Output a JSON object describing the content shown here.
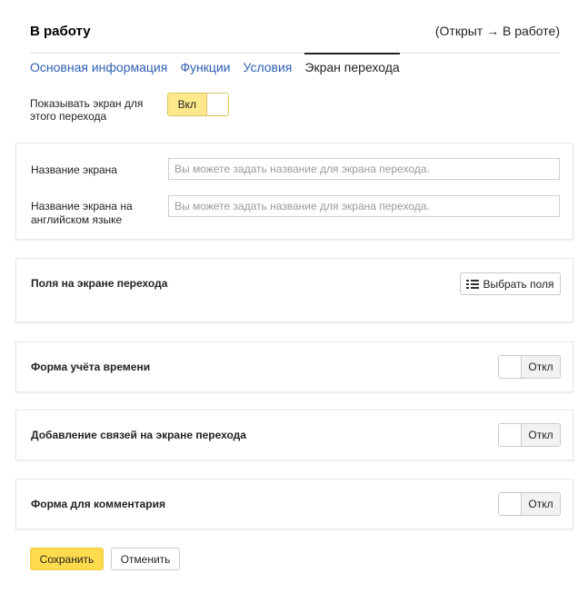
{
  "header": {
    "title": "В работу",
    "transition": "(Открыт → В работе)"
  },
  "tabs": [
    {
      "label": "Основная информация",
      "active": false
    },
    {
      "label": "Функции",
      "active": false
    },
    {
      "label": "Условия",
      "active": false
    },
    {
      "label": "Экран перехода",
      "active": true
    }
  ],
  "show_screen": {
    "label": "Показывать экран для этого перехода",
    "toggle_label": "Вкл",
    "enabled": true
  },
  "screen_name": {
    "label": "Название экрана",
    "placeholder": "Вы можете задать название для экрана перехода.",
    "value": ""
  },
  "screen_name_en": {
    "label": "Название экрана на английском языке",
    "placeholder": "Вы можете задать название для экрана перехода.",
    "value": ""
  },
  "fields_section": {
    "label": "Поля на экране перехода",
    "button_label": "Выбрать поля"
  },
  "time_tracking": {
    "label": "Форма учёта времени",
    "toggle_label": "Откл",
    "enabled": false
  },
  "links": {
    "label": "Добавление связей на экране перехода",
    "toggle_label": "Откл",
    "enabled": false
  },
  "comment_form": {
    "label": "Форма для комментария",
    "toggle_label": "Откл",
    "enabled": false
  },
  "actions": {
    "save_label": "Сохранить",
    "cancel_label": "Отменить"
  },
  "colors": {
    "accent": "#ffdb4d",
    "link": "#2f5fb3",
    "toggle_on": "#fde98c"
  }
}
